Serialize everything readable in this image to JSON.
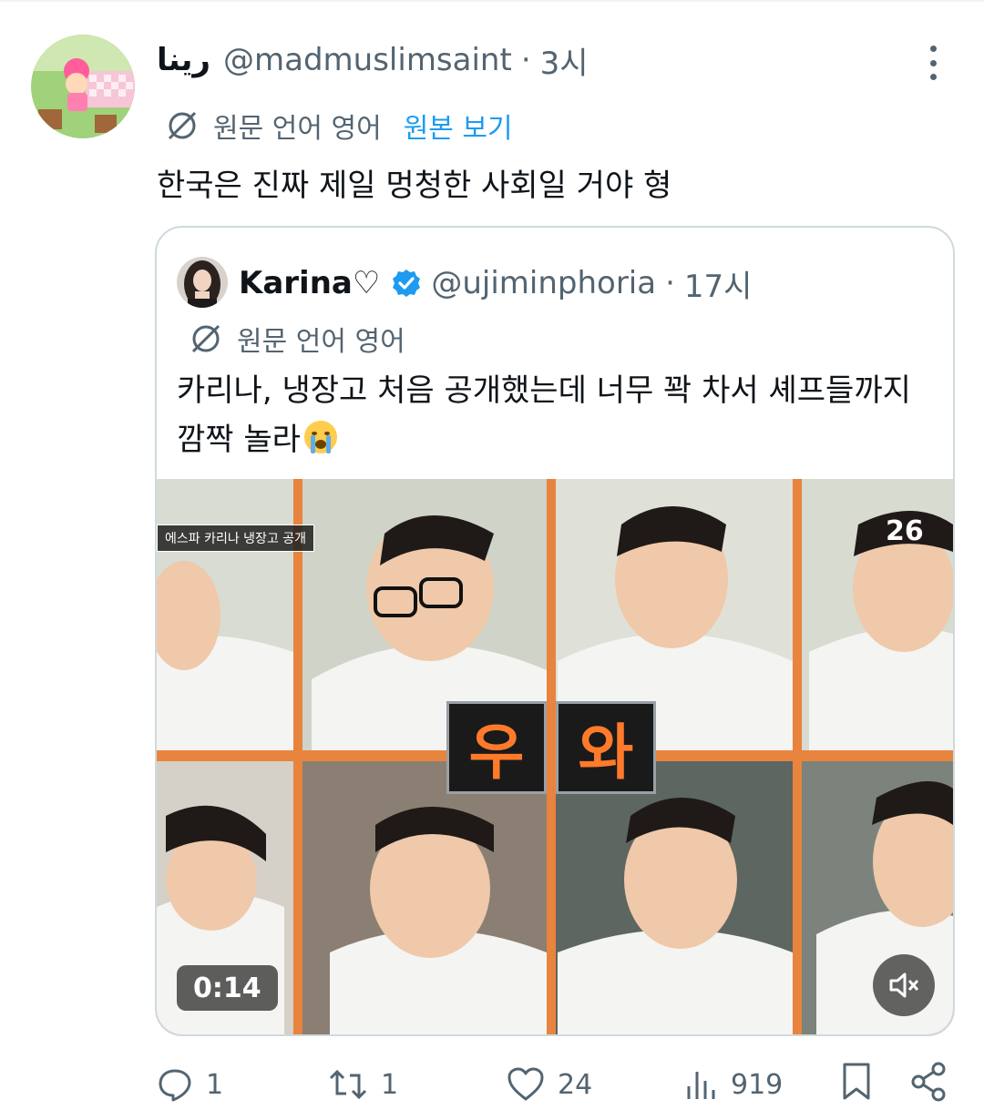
{
  "tweet": {
    "display_name": "رينا",
    "handle": "@madmuslimsaint",
    "time": "3시",
    "translation_label": "원문 언어 영어",
    "show_original_label": "원본 보기",
    "text": "한국은 진짜 제일 멍청한 사회일 거야 형"
  },
  "quoted": {
    "display_name": "Karina♡",
    "handle": "@ujiminphoria",
    "time": "17시",
    "translation_label": "원문 언어 영어",
    "text_line1": "카리나, 냉장고 처음 공개했는데 너무 꽉 차서 셰프들까지",
    "text_line2": "깜짝 놀라",
    "video": {
      "caption": "에스파 카리나 냉장고 공개",
      "overlay_char1": "우",
      "overlay_char2": "와",
      "duration": "0:14",
      "corner_logo": "26",
      "muted": true
    }
  },
  "actions": {
    "replies": "1",
    "reposts": "1",
    "likes": "24",
    "views": "919"
  },
  "colors": {
    "link": "#1d9bf0",
    "secondary_text": "#536471",
    "verified": "#1d9bf0"
  }
}
